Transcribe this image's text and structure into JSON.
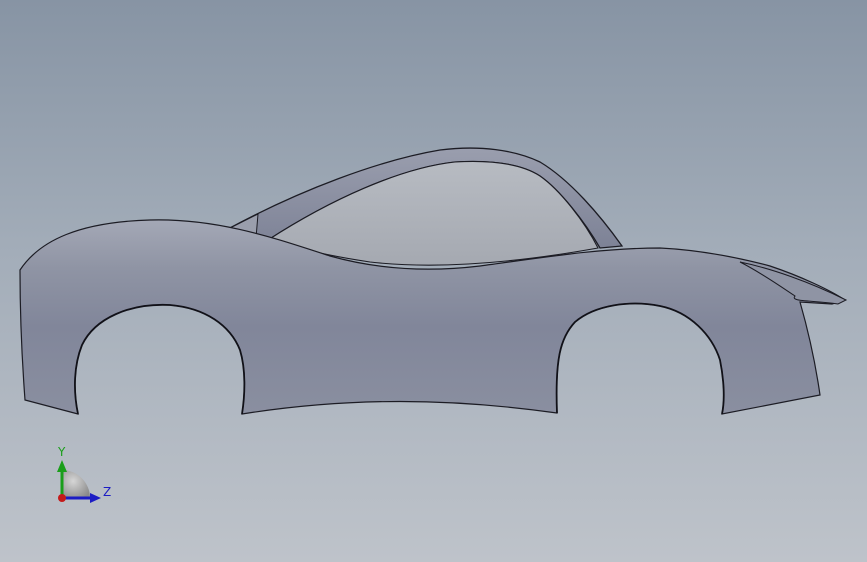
{
  "viewport": {
    "background_top": "#8794a4",
    "background_bottom": "#bec3ca"
  },
  "model": {
    "body_color": "#8e93a3",
    "window_color": "#aeb3ba",
    "edge_color": "#1c1c24"
  },
  "triad": {
    "y_label": "Y",
    "z_label": "Z",
    "y_color": "#1a9e1a",
    "z_color": "#1c1cc4",
    "origin_color": "#c41a1a"
  }
}
